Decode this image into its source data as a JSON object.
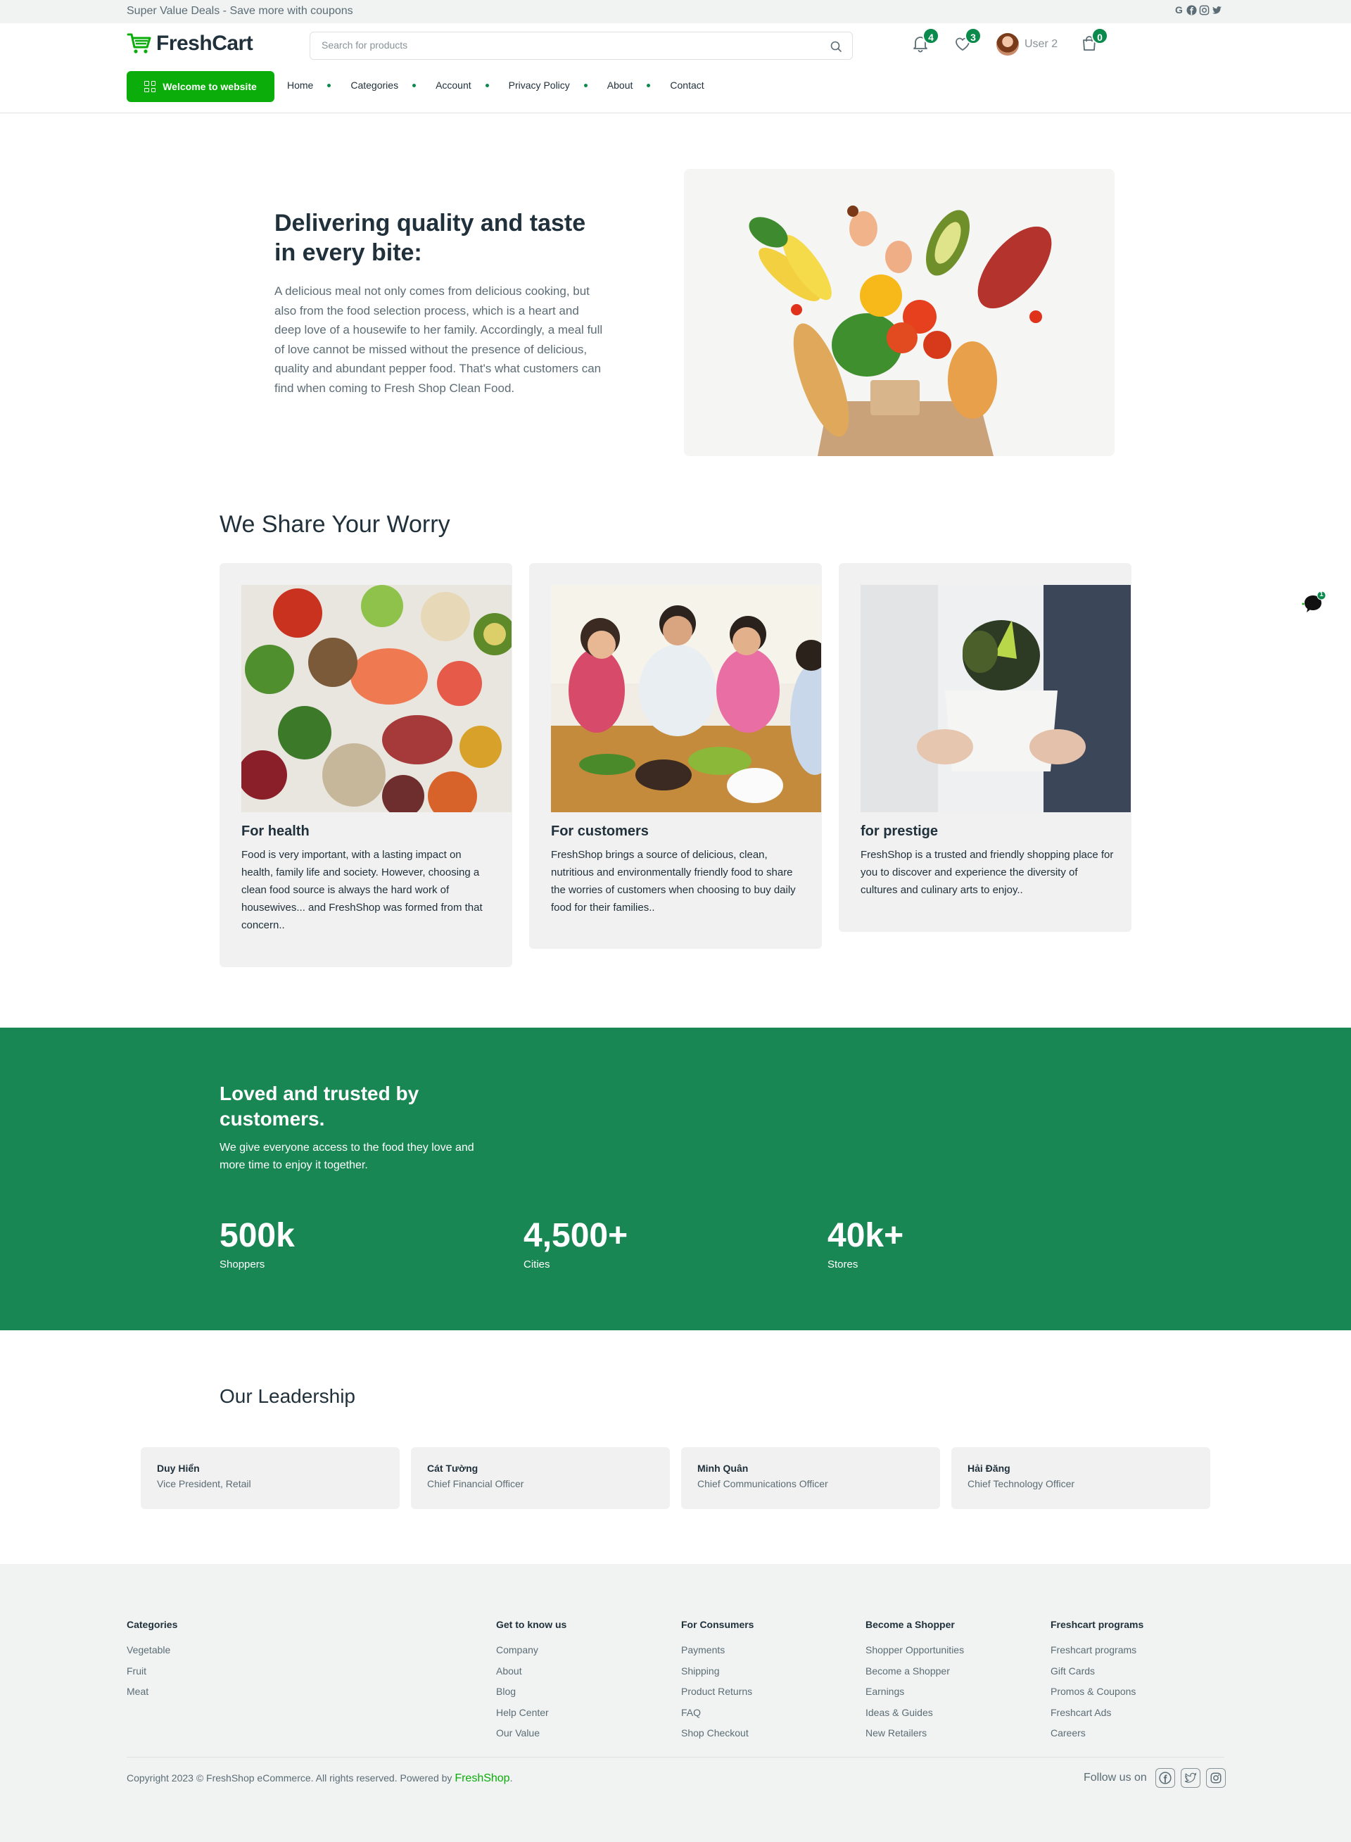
{
  "topbar": {
    "promo": "Super Value Deals - Save more with coupons",
    "social_icons": [
      "google-icon",
      "facebook-icon",
      "instagram-icon",
      "twitter-icon"
    ]
  },
  "header": {
    "logo_text": "FreshCart",
    "search_placeholder": "Search for products",
    "notifications_count": "4",
    "wishlist_count": "3",
    "user_name": "User 2",
    "cart_count": "0"
  },
  "nav": {
    "welcome_label": "Welcome to website",
    "items": [
      "Home",
      "Categories",
      "Account",
      "Privacy Policy",
      "About",
      "Contact"
    ]
  },
  "hero": {
    "title": "Delivering quality and taste in every bite:",
    "text": "A delicious meal not only comes from delicious cooking, but also from the food selection process, which is a heart and deep love of a housewife to her family. Accordingly, a meal full of love cannot be missed without the presence of delicious, quality and abundant pepper food. That's what customers can find when coming to Fresh Shop Clean Food."
  },
  "worry": {
    "title": "We Share Your Worry",
    "cards": [
      {
        "title": "For health",
        "text": "Food is very important, with a lasting impact on health, family life and society. However, choosing a clean food source is always the hard work of housewives... and FreshShop was formed from that concern.."
      },
      {
        "title": "For customers",
        "text": "FreshShop brings a source of delicious, clean, nutritious and environmentally friendly food to share the worries of customers when choosing to buy daily food for their families.."
      },
      {
        "title": "for prestige",
        "text": "FreshShop is a trusted and friendly shopping place for you to discover and experience the diversity of cultures and culinary arts to enjoy.."
      }
    ]
  },
  "chat": {
    "badge": "1"
  },
  "trust": {
    "title": "Loved and trusted by customers.",
    "text": "We give everyone access to the food they love and more time to enjoy it together.",
    "stats": [
      {
        "value": "500k",
        "label": "Shoppers"
      },
      {
        "value": "4,500+",
        "label": "Cities"
      },
      {
        "value": "40k+",
        "label": "Stores"
      }
    ]
  },
  "leadership": {
    "title": "Our Leadership",
    "members": [
      {
        "name": "Duy Hiển",
        "role": "Vice President, Retail"
      },
      {
        "name": "Cát Tường",
        "role": "Chief Financial Officer"
      },
      {
        "name": "Minh Quân",
        "role": "Chief Communications Officer"
      },
      {
        "name": "Hải Đăng",
        "role": "Chief Technology Officer"
      }
    ]
  },
  "footer": {
    "columns": [
      {
        "heading": "Categories",
        "links": [
          "Vegetable",
          "Fruit",
          "Meat"
        ]
      },
      {
        "heading": "Get to know us",
        "links": [
          "Company",
          "About",
          "Blog",
          "Help Center",
          "Our Value"
        ]
      },
      {
        "heading": "For Consumers",
        "links": [
          "Payments",
          "Shipping",
          "Product Returns",
          "FAQ",
          "Shop Checkout"
        ]
      },
      {
        "heading": "Become a Shopper",
        "links": [
          "Shopper Opportunities",
          "Become a Shopper",
          "Earnings",
          "Ideas & Guides",
          "New Retailers"
        ]
      },
      {
        "heading": "Freshcart programs",
        "links": [
          "Freshcart programs",
          "Gift Cards",
          "Promos & Coupons",
          "Freshcart Ads",
          "Careers"
        ]
      }
    ],
    "copyright": "Copyright 2023 © FreshShop eCommerce. All rights reserved. Powered by ",
    "copyright_brand": "FreshShop",
    "copyright_end": ".",
    "follow_label": "Follow us on"
  },
  "colors": {
    "primary": "#0aad0a",
    "band": "#198754",
    "badge": "#0a8a4c"
  }
}
